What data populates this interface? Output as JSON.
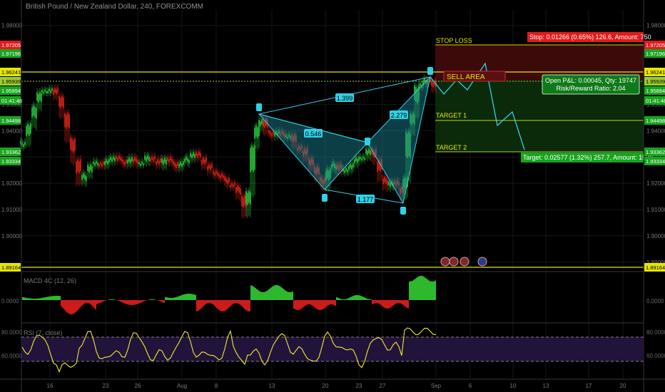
{
  "header": {
    "title": "British Pound / New Zealand Dollar, 240, FOREXCOMM"
  },
  "panes": {
    "macd_label": "MACD 4C (12, 26)",
    "rsi_label": "RSI (7, close)"
  },
  "colors": {
    "up": "#26a69a",
    "down": "#ef5350",
    "green_candle": "#2ecc40",
    "red_candle": "#e0261a",
    "pattern": "#2fd1e8",
    "stop_tag": "#e01b1b",
    "target_tag": "#17a51f",
    "yellow_line": "#e6e600",
    "rsi_line": "#f2e935",
    "rsi_band": "#2a1740"
  },
  "annotations": {
    "stop_loss": "STOP LOSS",
    "sell_area": "SELL AREA",
    "target1": "TARGET 1",
    "target2": "TARGET 2",
    "stop_box": "Stop: 0.01266 (0.65%) 126.6, Amount: 750",
    "pnl_line1": "Open P&L: 0.00045, Qty: 19747",
    "pnl_line2": "Risk/Reward Ratio: 2.04",
    "target_box": "Target: 0.02577 (1.32%) 257.7, Amount: 1508"
  },
  "chart_data": {
    "type": "candlestick",
    "title": "British Pound / New Zealand Dollar, 240, FOREXCOMM",
    "x_ticks": [
      "16",
      "23",
      "26",
      "Aug",
      "8",
      "13",
      "20",
      "23",
      "27",
      "Sep",
      "6",
      "10",
      "13",
      "17",
      "20"
    ],
    "y_ticks_right": [
      "1.98000",
      "1.95000",
      "1.94000",
      "1.93000",
      "1.92000",
      "1.91000",
      "1.90000",
      "1.89000"
    ],
    "y_ticks_left": [
      "1.98000",
      "1.95000",
      "1.94000",
      "1.92000",
      "1.91000",
      "1.90000"
    ],
    "price_tags": [
      {
        "value": "1.97205",
        "kind": "stop"
      },
      {
        "value": "1.97196",
        "kind": "green"
      },
      {
        "value": "1.96241",
        "kind": "yellow"
      },
      {
        "value": "1.95939",
        "kind": "current"
      },
      {
        "value": "1.95894",
        "kind": "green"
      },
      {
        "value": "01:41:48",
        "kind": "timer"
      },
      {
        "value": "1.94498",
        "kind": "green"
      },
      {
        "value": "1.93362",
        "kind": "target"
      },
      {
        "value": "1.93334",
        "kind": "green"
      },
      {
        "value": "1.89164",
        "kind": "yellow"
      }
    ],
    "horizontal_levels": [
      1.96241,
      1.89164
    ],
    "pattern_points": [
      {
        "label": "X",
        "value": 1.945
      },
      {
        "label": "A",
        "value": 1.9202
      },
      {
        "label": "B",
        "value": 1.935
      },
      {
        "label": "C",
        "value": 1.9155
      },
      {
        "label": "D",
        "value": 1.962
      }
    ],
    "ratios": [
      "1.399",
      "0.546",
      "2.279",
      "1.177"
    ],
    "stop_loss": 1.97205,
    "target1": 1.94498,
    "target2": 1.93362,
    "macd_tick": "0.0000",
    "rsi_ticks": [
      "80.0000",
      "60.0000"
    ],
    "grid": true,
    "legend": "none"
  }
}
